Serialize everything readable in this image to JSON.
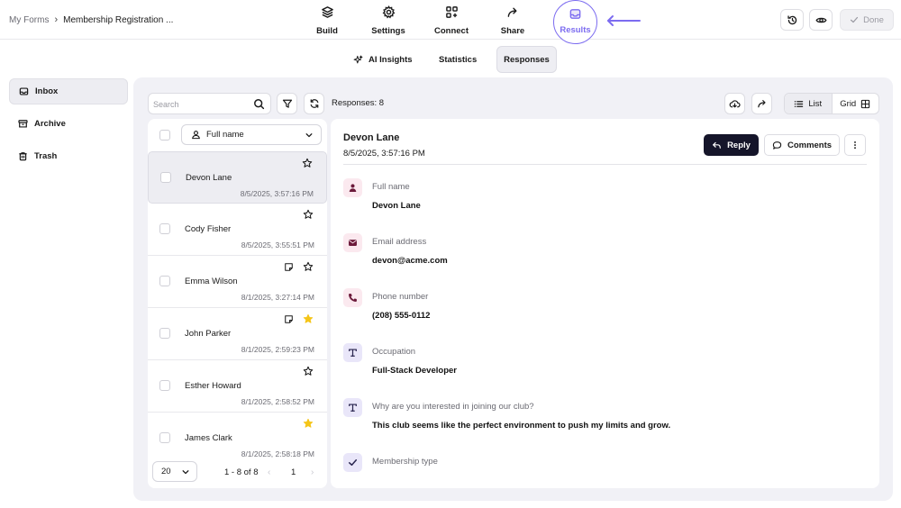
{
  "breadcrumb": {
    "root": "My Forms",
    "separator": "›",
    "current": "Membership Registration ..."
  },
  "nav": {
    "build": "Build",
    "settings": "Settings",
    "connect": "Connect",
    "share": "Share",
    "results": "Results"
  },
  "topright": {
    "done": "Done"
  },
  "tabs": {
    "ai": "AI Insights",
    "stats": "Statistics",
    "responses": "Responses"
  },
  "sidebar": {
    "items": [
      {
        "label": "Inbox"
      },
      {
        "label": "Archive"
      },
      {
        "label": "Trash"
      }
    ]
  },
  "toolbar": {
    "search_placeholder": "Search",
    "responses_count": "Responses: 8",
    "view_list": "List",
    "view_grid": "Grid"
  },
  "list": {
    "field_select": "Full name",
    "rows": [
      {
        "name": "Devon Lane",
        "date": "8/5/2025, 3:57:16 PM",
        "starred": false,
        "note": false,
        "selected": true
      },
      {
        "name": "Cody Fisher",
        "date": "8/5/2025, 3:55:51 PM",
        "starred": false,
        "note": false,
        "selected": false
      },
      {
        "name": "Emma Wilson",
        "date": "8/1/2025, 3:27:14 PM",
        "starred": false,
        "note": true,
        "selected": false
      },
      {
        "name": "John Parker",
        "date": "8/1/2025, 2:59:23 PM",
        "starred": true,
        "note": true,
        "selected": false
      },
      {
        "name": "Esther Howard",
        "date": "8/1/2025, 2:58:52 PM",
        "starred": false,
        "note": false,
        "selected": false
      },
      {
        "name": "James Clark",
        "date": "8/1/2025, 2:58:18 PM",
        "starred": true,
        "note": false,
        "selected": false
      }
    ],
    "page_size": "20",
    "page_info": "1 - 8 of 8",
    "page_number": "1"
  },
  "detail": {
    "name": "Devon Lane",
    "date": "8/5/2025, 3:57:16 PM",
    "reply": "Reply",
    "comments": "Comments",
    "fields": [
      {
        "label": "Full name",
        "value": "Devon Lane",
        "icon": "person-icon"
      },
      {
        "label": "Email address",
        "value": "devon@acme.com",
        "icon": "mail-icon"
      },
      {
        "label": "Phone number",
        "value": "(208) 555-0112",
        "icon": "phone-icon"
      },
      {
        "label": "Occupation",
        "value": "Full-Stack Developer",
        "icon": "text-icon"
      },
      {
        "label": "Why are you interested in joining our club?",
        "value": "This club seems like the perfect environment to push my limits and grow.",
        "icon": "text-icon"
      },
      {
        "label": "Membership type",
        "value": "",
        "icon": "check-icon"
      }
    ]
  },
  "colors": {
    "accent": "#7c6cf0",
    "dark_button": "#15152a",
    "star_gold": "#f5c518",
    "pink_icon_bg": "#fbe9ef",
    "purple_icon_bg": "#e9e6f9",
    "panel_bg": "#f1f1f6"
  }
}
